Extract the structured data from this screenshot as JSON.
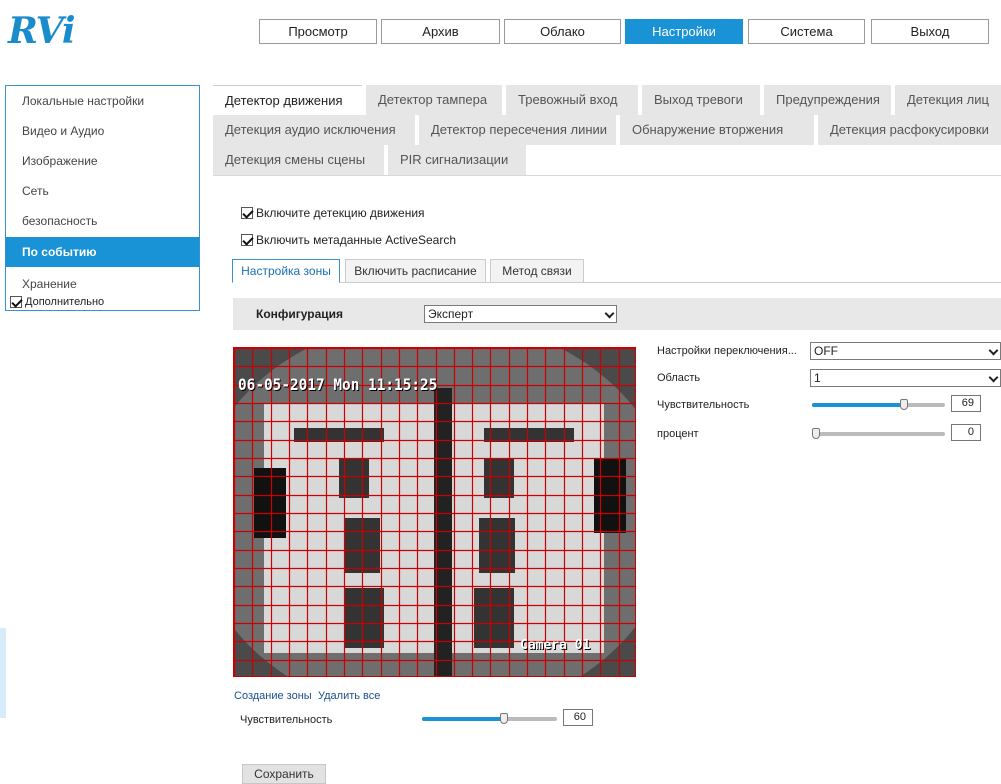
{
  "logo": "RVi",
  "nav": [
    {
      "label": "Просмотр",
      "active": false
    },
    {
      "label": "Архив",
      "active": false
    },
    {
      "label": "Облако",
      "active": false
    },
    {
      "label": "Настройки",
      "active": true
    },
    {
      "label": "Система",
      "active": false
    },
    {
      "label": "Выход",
      "active": false
    }
  ],
  "sidebar": {
    "items": [
      {
        "label": "Локальные настройки"
      },
      {
        "label": "Видео и Аудио"
      },
      {
        "label": "Изображение"
      },
      {
        "label": "Сеть"
      },
      {
        "label": "безопасность"
      },
      {
        "label": "По событию",
        "active": true
      },
      {
        "label": "Хранение"
      }
    ],
    "extra_label": "Дополнительно",
    "extra_checked": true
  },
  "tabs": {
    "row1": [
      "Детектор движения",
      "Детектор тампера",
      "Тревожный вход",
      "Выход тревоги",
      "Предупреждения",
      "Детекция лиц"
    ],
    "row2": [
      "Детекция аудио исключения",
      "Детектор пересечения линии",
      "Обнаружение вторжения",
      "Детекция расфокусировки"
    ],
    "row3": [
      "Детекция смены сцены",
      "PIR сигнализации"
    ],
    "active": "Детектор движения"
  },
  "checks": {
    "motion": {
      "label": "Включите детекцию движения",
      "checked": true
    },
    "metadata": {
      "label": "Включить метаданные ActiveSearch",
      "checked": true
    }
  },
  "subtabs": [
    "Настройка зоны",
    "Включить расписание",
    "Метод связи"
  ],
  "config": {
    "label": "Конфигурация",
    "value": "Эксперт"
  },
  "video": {
    "timestamp": "06-05-2017 Mon 11:15:25",
    "camera": "Camera 01",
    "grid_color": "#cc0000"
  },
  "right_panel": {
    "switch_label": "Настройки переключения...",
    "switch_value": "OFF",
    "area_label": "Область",
    "area_value": "1",
    "sensitivity_label": "Чувствительность",
    "sensitivity_value": "69",
    "percent_label": "процент",
    "percent_value": "0"
  },
  "zone": {
    "create_label": "Создание зоны",
    "delete_label": "Удалить все",
    "sensitivity_label": "Чувствительность",
    "sensitivity_value": "60"
  },
  "save_label": "Сохранить",
  "colors": {
    "accent": "#1a92d6"
  }
}
